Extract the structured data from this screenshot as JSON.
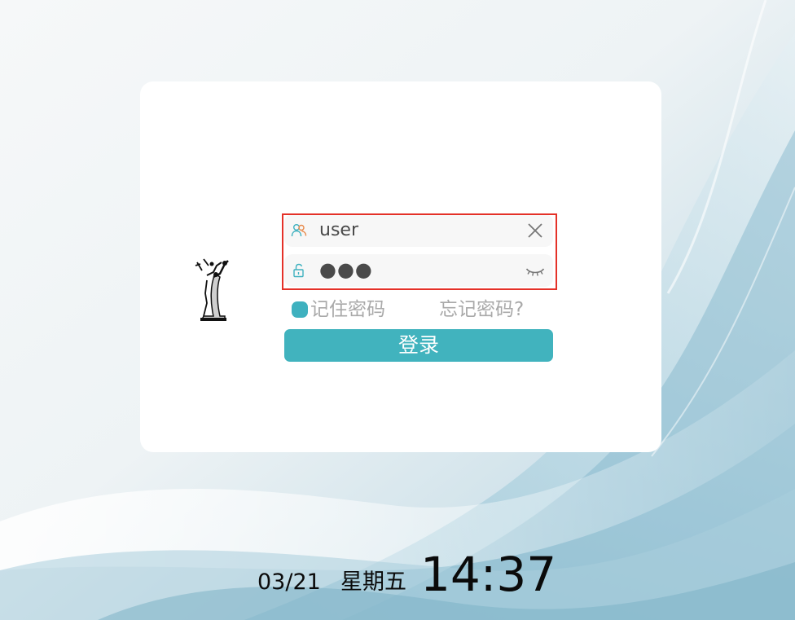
{
  "login": {
    "username": {
      "icon": "user-group-icon",
      "value": "user",
      "clear_icon": "close-icon"
    },
    "password": {
      "icon": "lock-icon",
      "masked_value": "●●●",
      "toggle_icon": "eye-closed-icon"
    },
    "remember_label": "记住密码",
    "forgot_label": "忘记密码?",
    "submit_label": "登录"
  },
  "clock": {
    "date": "03/21",
    "weekday": "星期五",
    "time": "14:37"
  },
  "colors": {
    "accent": "#41b3be",
    "highlight_border": "#e43128",
    "muted_text": "#a9a9a9"
  }
}
